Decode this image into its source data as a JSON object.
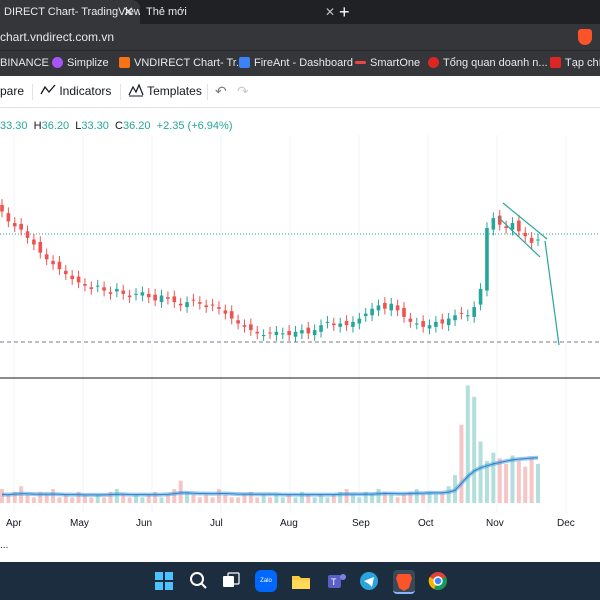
{
  "browser": {
    "active_tab_title": "DIRECT Chart- TradingView",
    "active_tab_close": "✕",
    "new_tab_title": "Thẻ mới",
    "new_tab_close": "✕",
    "new_tab_button": "+",
    "url": "chart.vndirect.com.vn"
  },
  "bookmarks": [
    {
      "label": "BINANCE",
      "icon": "binance-icon",
      "color": "#f3ba2f"
    },
    {
      "label": "Simplize",
      "icon": "simplize-icon",
      "color": "#a855f7"
    },
    {
      "label": "VNDIRECT Chart- Tr...",
      "icon": "vndirect-icon",
      "color": "#f97316"
    },
    {
      "label": "FireAnt - Dashboard",
      "icon": "fireant-icon",
      "color": "#3b82f6"
    },
    {
      "label": "SmartOne",
      "icon": "smartone-icon",
      "color": "#ef4444"
    },
    {
      "label": "Tổng quan doanh n...",
      "icon": "tongquan-icon",
      "color": "#dc2626"
    },
    {
      "label": "Tạp chí",
      "icon": "tapchi-icon",
      "color": "#dc2626"
    }
  ],
  "toolbar": {
    "compare": "pare",
    "indicators": "Indicators",
    "templates": "Templates"
  },
  "ohlc": {
    "open": "33.30",
    "high_label": "H",
    "high": "36.20",
    "low_label": "L",
    "low": "33.30",
    "close_label": "C",
    "close": "36.20",
    "change": "+2.35 (+6.94%)"
  },
  "chart_data": {
    "type": "candlestick",
    "x_ticks": [
      "Apr",
      "May",
      "Jun",
      "Jul",
      "Aug",
      "Sep",
      "Oct",
      "Nov",
      "Dec"
    ],
    "colors": {
      "up": "#26a69a",
      "down": "#ef5350",
      "volume_ma": "#4aa3df"
    },
    "price_series": [
      35.8,
      35.2,
      34.9,
      34.7,
      34.2,
      33.8,
      33.3,
      32.9,
      32.6,
      32.3,
      32.0,
      31.7,
      31.5,
      31.3,
      31.1,
      31.3,
      31.0,
      30.8,
      31.1,
      30.8,
      30.6,
      30.8,
      30.9,
      30.6,
      30.4,
      30.7,
      30.5,
      30.3,
      30.1,
      30.3,
      30.4,
      30.2,
      30.0,
      30.1,
      29.9,
      29.6,
      29.3,
      29.0,
      28.8,
      28.6,
      28.4,
      28.3,
      28.4,
      28.5,
      28.4,
      28.3,
      28.5,
      28.6,
      28.4,
      28.6,
      28.9,
      29.1,
      28.9,
      29.0,
      28.9,
      29.1,
      29.3,
      29.6,
      29.9,
      30.1,
      29.9,
      30.2,
      29.8,
      29.4,
      29.1,
      29.0,
      28.8,
      28.9,
      29.1,
      29.0,
      29.3,
      29.5,
      29.6,
      29.5,
      30.0,
      31.1,
      34.8,
      35.4,
      35.0,
      34.8,
      35.1,
      34.6,
      34.3,
      33.9,
      34.1
    ],
    "volume_series": [
      5,
      3,
      4,
      6,
      3,
      2,
      4,
      3,
      5,
      2,
      3,
      2,
      4,
      3,
      2,
      3,
      2,
      4,
      5,
      3,
      2,
      3,
      2,
      3,
      4,
      2,
      3,
      5,
      8,
      4,
      3,
      2,
      3,
      2,
      5,
      3,
      2,
      2,
      3,
      4,
      2,
      3,
      2,
      3,
      2,
      3,
      2,
      4,
      3,
      2,
      3,
      2,
      3,
      4,
      5,
      3,
      2,
      4,
      3,
      5,
      4,
      3,
      2,
      3,
      4,
      5,
      3,
      4,
      3,
      4,
      6,
      10,
      28,
      42,
      38,
      22,
      15,
      18,
      16,
      14,
      17,
      15,
      13,
      16,
      14
    ],
    "volume_ma_series": [
      3,
      3,
      3.2,
      3.3,
      3.3,
      3.2,
      3.1,
      3.2,
      3.2,
      3.1,
      3,
      3,
      3,
      2.9,
      2.9,
      2.9,
      2.9,
      3,
      3.1,
      3.1,
      3,
      3,
      3,
      3,
      3,
      3,
      3.1,
      3.3,
      3.6,
      3.6,
      3.5,
      3.4,
      3.4,
      3.3,
      3.4,
      3.4,
      3.3,
      3.2,
      3.2,
      3.2,
      3.1,
      3.1,
      3.1,
      3.1,
      3,
      3,
      3,
      3,
      3,
      3,
      3,
      3,
      3,
      3.1,
      3.2,
      3.2,
      3.1,
      3.2,
      3.2,
      3.3,
      3.4,
      3.4,
      3.3,
      3.3,
      3.4,
      3.5,
      3.5,
      3.6,
      3.6,
      3.7,
      3.9,
      4.5,
      7,
      9.5,
      11.5,
      12.6,
      13.3,
      14,
      14.5,
      15,
      15.4,
      15.7,
      15.9,
      16.1,
      16.2
    ]
  },
  "taskbar": {
    "zalo_label": "Zalo"
  }
}
